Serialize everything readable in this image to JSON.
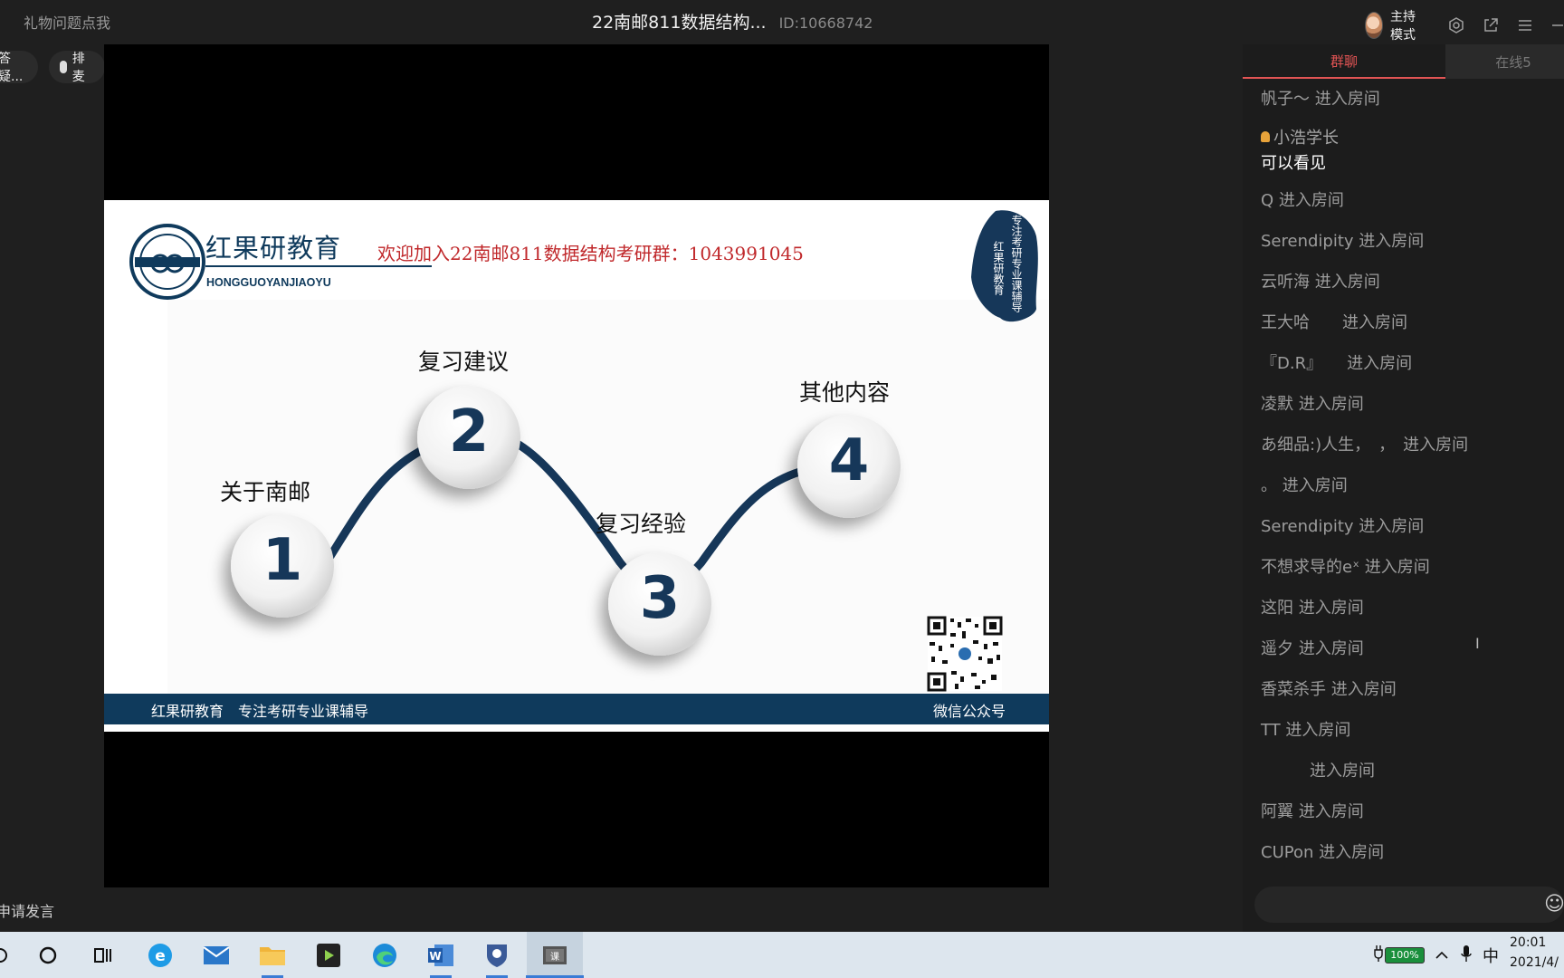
{
  "topbar": {
    "gift_link": "礼物问题点我",
    "title": "22南邮811数据结构...",
    "room_id": "ID:10668742",
    "host_mode": "主持模式"
  },
  "pills": {
    "qa": "答疑...",
    "mic": "排麦"
  },
  "slide": {
    "logo_cn": "红果研教育",
    "logo_en": "HONGGUOYANJIAOYU",
    "welcome": "欢迎加入22南邮811数据结构考研群：1043991045",
    "seal_col1": "专注考研专业课辅导",
    "seal_col2": "红果研教育",
    "steps": [
      {
        "num": "1",
        "label": "关于南邮"
      },
      {
        "num": "2",
        "label": "复习建议"
      },
      {
        "num": "3",
        "label": "复习经验"
      },
      {
        "num": "4",
        "label": "其他内容"
      }
    ],
    "banner_left": "红果研教育　专注考研专业课辅导",
    "banner_right": "微信公众号",
    "colors": {
      "navy": "#0f3a5c",
      "red": "#c0282b"
    }
  },
  "chat": {
    "tab_group": "群聊",
    "tab_online": "在线5",
    "messages": [
      {
        "text": "帆子～ 进入房间"
      },
      {
        "sender": "小浩学长",
        "text": "可以看见",
        "badge": "host-badge-icon"
      },
      {
        "text": "Q 进入房间"
      },
      {
        "text": "Serendipity 进入房间"
      },
      {
        "text": "云听海 进入房间"
      },
      {
        "text": "王大哈　　进入房间"
      },
      {
        "text": "『D.R』　　进入房间"
      },
      {
        "text": "凌默 进入房间"
      },
      {
        "text": "あ细品:)人生，　，　进入房间"
      },
      {
        "text": "。 进入房间"
      },
      {
        "text": "Serendipity 进入房间"
      },
      {
        "text": "不想求导的eˣ 进入房间"
      },
      {
        "text": "这阳 进入房间"
      },
      {
        "text": "遥夕 进入房间"
      },
      {
        "text": "香菜杀手 进入房间"
      },
      {
        "text": "TT 进入房间"
      },
      {
        "text": "　　　进入房间"
      },
      {
        "text": "阿翼 进入房间"
      },
      {
        "text": "CUPon 进入房间"
      }
    ]
  },
  "footer": {
    "apply_speak": "申请发言"
  },
  "taskbar": {
    "battery": "100%",
    "ime": "中",
    "time": "20:01",
    "date": "2021/4/"
  }
}
